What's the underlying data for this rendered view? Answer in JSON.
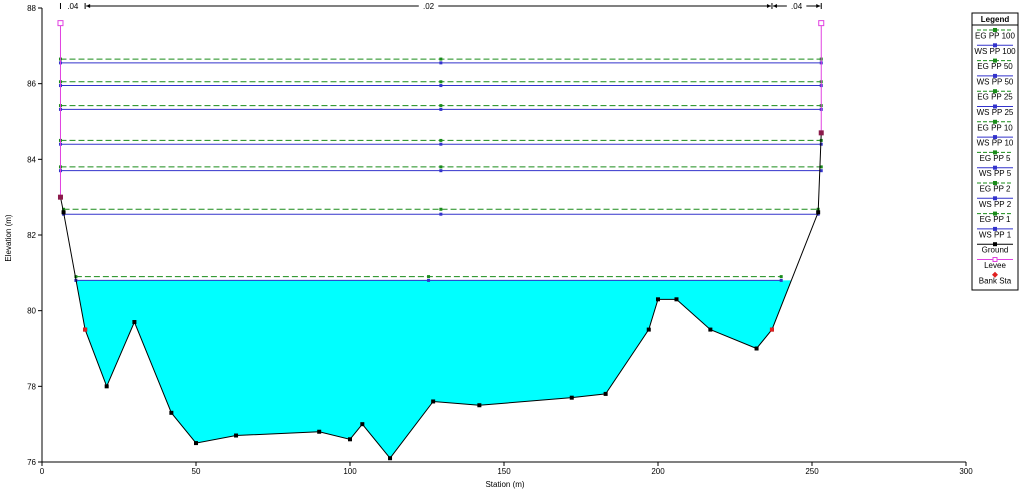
{
  "chart_data": {
    "type": "line",
    "xlabel": "Station (m)",
    "ylabel": "Elevation (m)",
    "xlim": [
      0,
      300
    ],
    "ylim": [
      76,
      88
    ],
    "xticks": [
      "0",
      "50",
      "100",
      "150",
      "200",
      "250",
      "300"
    ],
    "yticks": [
      "76",
      "78",
      "80",
      "82",
      "84",
      "86",
      "88"
    ],
    "grid": false,
    "legend_position": "right",
    "legend_title": "Legend",
    "mannings_n": [
      {
        "label": ".04",
        "from": 6,
        "to": 14
      },
      {
        "label": ".02",
        "from": 14,
        "to": 237
      },
      {
        "label": ".04",
        "from": 237,
        "to": 253
      }
    ],
    "ground": {
      "name": "Ground",
      "x": [
        6,
        7,
        14,
        21,
        30,
        42,
        50,
        63,
        90,
        100,
        104,
        113,
        127,
        142,
        172,
        183,
        197,
        200,
        206,
        217,
        232,
        237,
        252,
        253
      ],
      "y": [
        83.0,
        82.6,
        79.5,
        78.0,
        79.7,
        77.3,
        76.5,
        76.7,
        76.8,
        76.6,
        77.0,
        76.1,
        77.6,
        77.5,
        77.7,
        77.8,
        79.5,
        80.3,
        80.3,
        79.5,
        79.0,
        79.5,
        82.6,
        84.7
      ]
    },
    "levee": {
      "name": "Levee",
      "points": [
        {
          "x": 6,
          "y0": 83.0,
          "y1": 87.6
        },
        {
          "x": 253,
          "y0": 84.7,
          "y1": 87.6
        }
      ]
    },
    "bank_stations": {
      "name": "Bank Sta",
      "x": [
        14,
        237
      ],
      "y": [
        79.5,
        79.5
      ]
    },
    "water_fill_level": 80.8,
    "profiles": [
      {
        "name": "EG PP 100",
        "type": "EG",
        "y": 86.65,
        "x0": 6,
        "x1": 253
      },
      {
        "name": "WS PP 100",
        "type": "WS",
        "y": 86.55,
        "x0": 6,
        "x1": 253
      },
      {
        "name": "EG PP 50",
        "type": "EG",
        "y": 86.05,
        "x0": 6,
        "x1": 253
      },
      {
        "name": "WS PP 50",
        "type": "WS",
        "y": 85.95,
        "x0": 6,
        "x1": 253
      },
      {
        "name": "EG PP 25",
        "type": "EG",
        "y": 85.42,
        "x0": 6,
        "x1": 253
      },
      {
        "name": "WS PP 25",
        "type": "WS",
        "y": 85.32,
        "x0": 6,
        "x1": 253
      },
      {
        "name": "EG PP 10",
        "type": "EG",
        "y": 84.5,
        "x0": 6,
        "x1": 253
      },
      {
        "name": "WS PP 10",
        "type": "WS",
        "y": 84.4,
        "x0": 6,
        "x1": 253
      },
      {
        "name": "EG PP 5",
        "type": "EG",
        "y": 83.8,
        "x0": 6,
        "x1": 253
      },
      {
        "name": "WS PP 5",
        "type": "WS",
        "y": 83.7,
        "x0": 6,
        "x1": 253
      },
      {
        "name": "EG PP 2",
        "type": "EG",
        "y": 82.68,
        "x0": 7,
        "x1": 252
      },
      {
        "name": "WS PP 2",
        "type": "WS",
        "y": 82.55,
        "x0": 7,
        "x1": 252
      },
      {
        "name": "EG PP 1",
        "type": "EG",
        "y": 80.9,
        "x0": 11,
        "x1": 240
      },
      {
        "name": "WS PP 1",
        "type": "WS",
        "y": 80.8,
        "x0": 11,
        "x1": 240
      }
    ],
    "legend_entries": [
      "EG PP 100",
      "WS PP 100",
      "EG PP 50",
      "WS PP 50",
      "EG PP 25",
      "WS PP 25",
      "EG PP 10",
      "WS PP 10",
      "EG PP 5",
      "WS PP 5",
      "EG PP 2",
      "WS PP 2",
      "EG PP 1",
      "WS PP 1",
      "Ground",
      "Levee",
      "Bank Sta"
    ],
    "colors": {
      "eg": "#1a8c1a",
      "ws": "#3333cc",
      "ground": "#000000",
      "levee": "#e040e0",
      "bank": "#e02020",
      "water": "#00ffff"
    }
  }
}
